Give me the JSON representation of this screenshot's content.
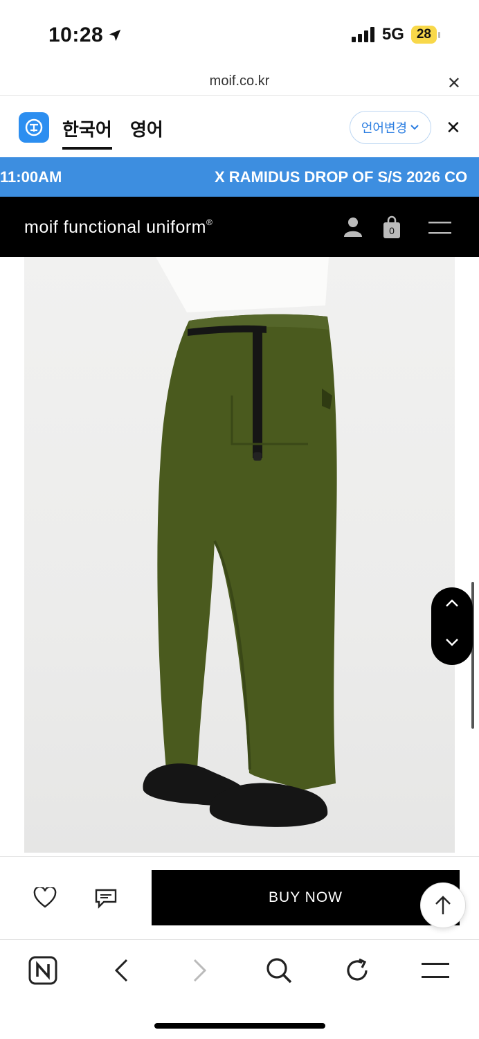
{
  "status_bar": {
    "time": "10:28",
    "network": "5G",
    "battery": "28"
  },
  "url_bar": {
    "domain": "moif.co.kr"
  },
  "translate_bar": {
    "tab_korean": "한국어",
    "tab_english": "영어",
    "change_language": "언어변경"
  },
  "announcement": {
    "left_text": "11:00AM",
    "right_text": "X RAMIDUS DROP OF S/S 2026 CO"
  },
  "header": {
    "brand": "moif  functional  uniform",
    "brand_mark": "®",
    "cart_count": "0"
  },
  "product": {
    "image_description": "olive green wide nylon pants with black belt",
    "colors": {
      "pants": "#4a5a1e",
      "shoes": "#151515"
    }
  },
  "actions": {
    "buy_now_label": "BUY NOW"
  },
  "colors": {
    "accent_blue": "#3d8ee0",
    "header_black": "#000000"
  }
}
